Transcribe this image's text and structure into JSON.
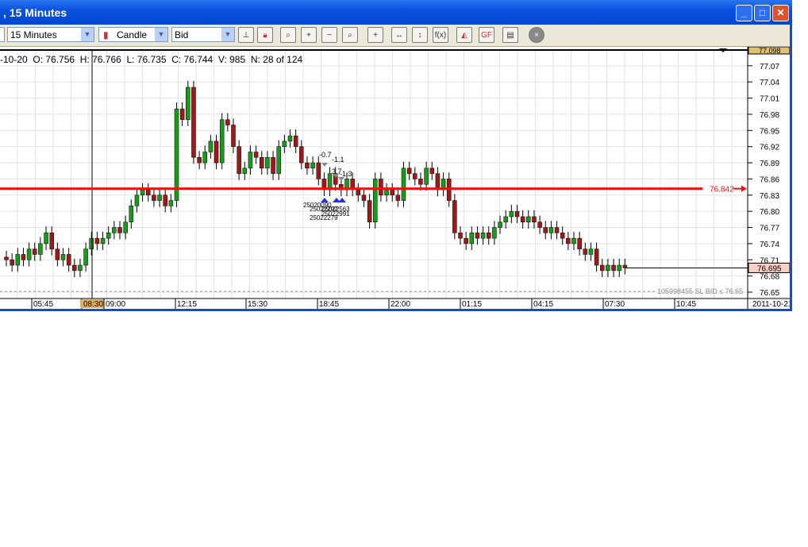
{
  "window": {
    "title": ", 15 Minutes"
  },
  "toolbar": {
    "interval": "15 Minutes",
    "chart_type": "Candle",
    "price_type": "Bid"
  },
  "info": {
    "date": "-10-20",
    "open": "O: 76.756",
    "high": "H: 76.766",
    "low": "L: 76.735",
    "close": "C: 76.744",
    "volume": "V: 985",
    "n": "N: 28 of 124"
  },
  "axis": {
    "top_label": "77.098",
    "y_ticks": [
      "77.07",
      "77.04",
      "77.01",
      "76.98",
      "76.95",
      "76.92",
      "76.89",
      "76.86",
      "76.83",
      "76.80",
      "76.77",
      "76.74",
      "76.71",
      "76.68",
      "76.65"
    ],
    "x_ticks": [
      "05:45",
      "08:30",
      "09:00",
      "12:15",
      "15:30",
      "18:45",
      "22:00",
      "01:15",
      "04:15",
      "07:30",
      "10:45"
    ],
    "date_label": "2011-10-21",
    "current_price": "76.695"
  },
  "line": {
    "price": "76.842",
    "color": "#ee1111"
  },
  "order": {
    "label": "105998455  SL BID  ≤ 76.65"
  },
  "annotations": [
    "-0.7",
    "-1.1",
    "3.7",
    "-1.3",
    "25020090",
    "25022292",
    "25022563",
    "25022991",
    "25022279"
  ],
  "chart_data": {
    "type": "candlestick",
    "ylim": [
      76.65,
      77.098
    ],
    "closes": [
      76.71,
      76.7,
      76.72,
      76.71,
      76.73,
      76.72,
      76.74,
      76.76,
      76.73,
      76.71,
      76.72,
      76.7,
      76.69,
      76.7,
      76.73,
      76.75,
      76.74,
      76.75,
      76.76,
      76.77,
      76.76,
      76.78,
      76.81,
      76.83,
      76.84,
      76.83,
      76.82,
      76.83,
      76.81,
      76.82,
      76.99,
      76.97,
      77.03,
      76.9,
      76.89,
      76.91,
      76.93,
      76.89,
      76.97,
      76.96,
      76.92,
      76.87,
      76.88,
      76.91,
      76.9,
      76.88,
      76.9,
      76.87,
      76.92,
      76.93,
      76.94,
      76.92,
      76.89,
      76.88,
      76.89,
      76.86,
      76.84,
      76.87,
      76.85,
      76.84,
      76.86,
      76.84,
      76.83,
      76.82,
      76.78,
      76.86,
      76.83,
      76.84,
      76.83,
      76.82,
      76.88,
      76.87,
      76.86,
      76.85,
      76.88,
      76.87,
      76.84,
      76.86,
      76.82,
      76.76,
      76.75,
      76.74,
      76.76,
      76.75,
      76.76,
      76.75,
      76.77,
      76.78,
      76.79,
      76.8,
      76.79,
      76.78,
      76.79,
      76.78,
      76.77,
      76.76,
      76.77,
      76.76,
      76.75,
      76.74,
      76.75,
      76.73,
      76.72,
      76.73,
      76.7,
      76.69,
      76.7,
      76.69,
      76.7,
      76.695
    ]
  }
}
